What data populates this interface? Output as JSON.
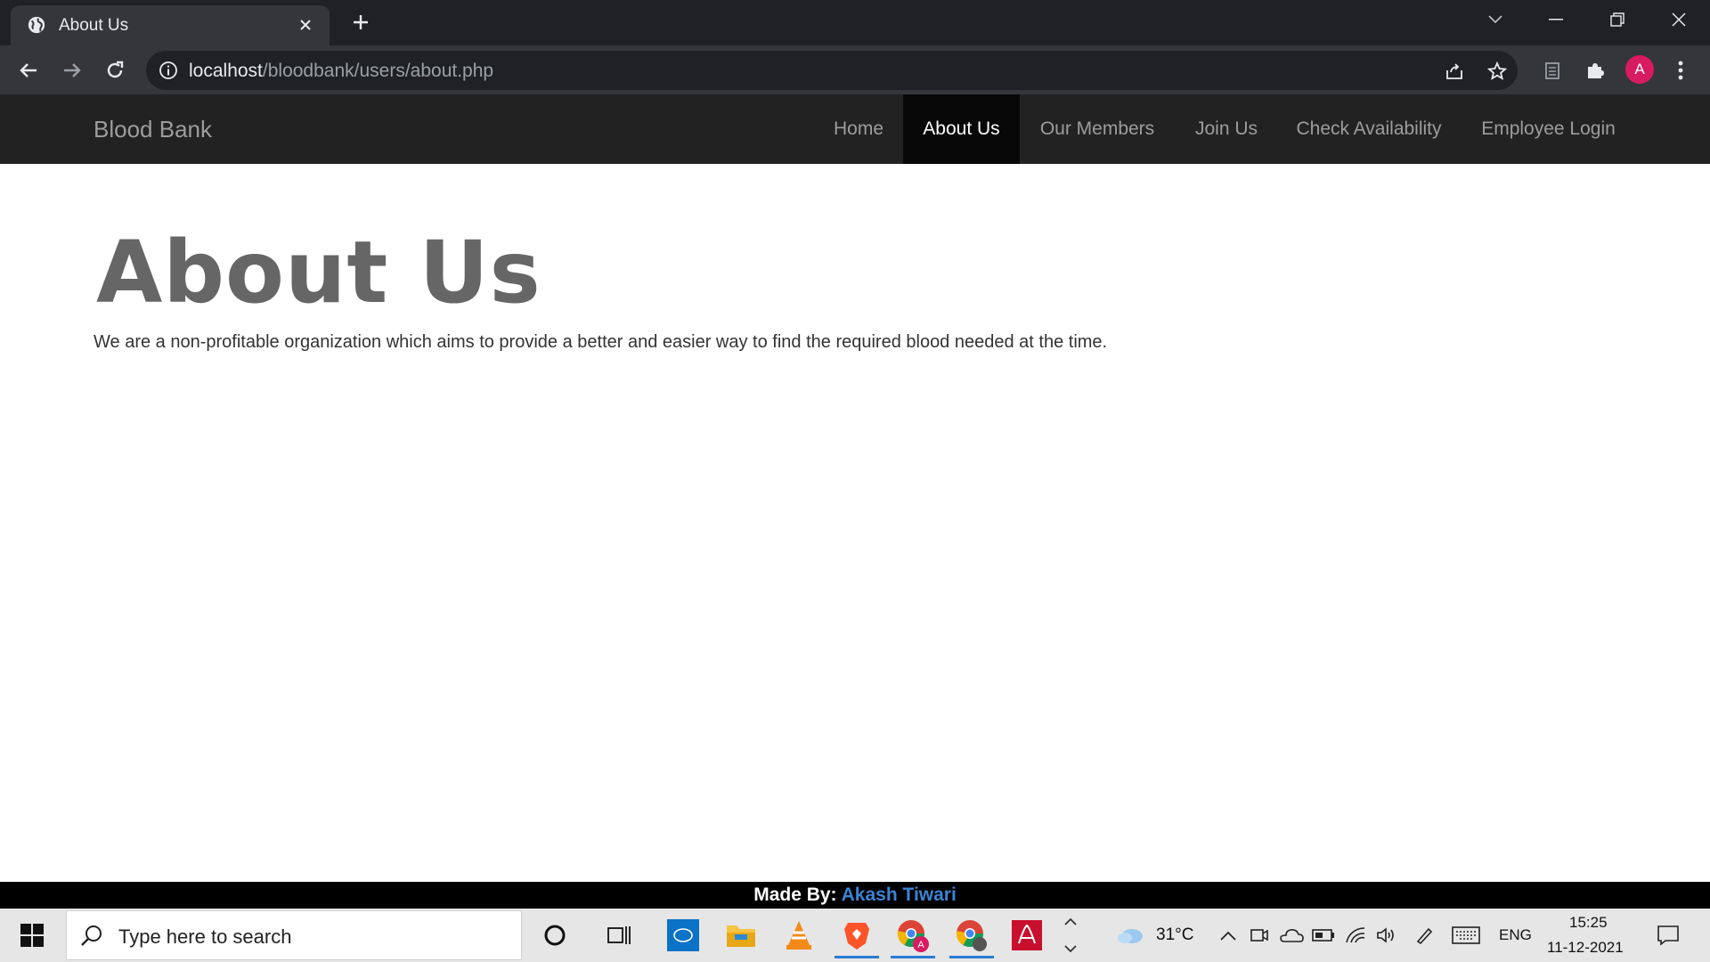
{
  "browser": {
    "tab_title": "About Us",
    "url_host": "localhost",
    "url_path": "/bloodbank/users/about.php",
    "profile_initial": "A"
  },
  "site": {
    "brand": "Blood Bank",
    "nav": [
      {
        "label": "Home"
      },
      {
        "label": "About Us",
        "active": true
      },
      {
        "label": "Our Members"
      },
      {
        "label": "Join Us"
      },
      {
        "label": "Check Availability"
      },
      {
        "label": "Employee Login"
      }
    ],
    "heading": "About Us",
    "paragraph": "We are a non-profitable organization which aims to provide a better and easier way to find the required blood needed at the time.",
    "footer_prefix": "Made By:",
    "footer_author": "Akash Tiwari"
  },
  "taskbar": {
    "search_placeholder": "Type here to search",
    "temperature": "31°C",
    "language": "ENG",
    "time": "15:25",
    "date": "11-12-2021"
  },
  "colors": {
    "navbar_bg": "#222222",
    "active_nav_bg": "#080808",
    "author_link": "#3b84d4",
    "profile_avatar": "#d81b60"
  }
}
